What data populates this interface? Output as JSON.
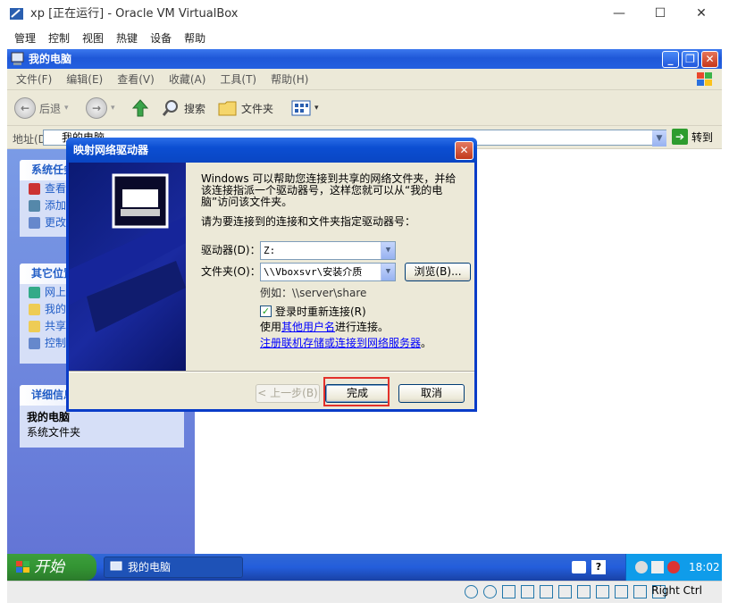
{
  "host": {
    "title": "xp [正在运行] - Oracle VM VirtualBox",
    "menu": [
      "管理",
      "控制",
      "视图",
      "热键",
      "设备",
      "帮助"
    ],
    "controls": {
      "minimize": "—",
      "maximize": "☐",
      "close": "✕"
    }
  },
  "explorer": {
    "title": "我的电脑",
    "menu": [
      "文件(F)",
      "编辑(E)",
      "查看(V)",
      "收藏(A)",
      "工具(T)",
      "帮助(H)"
    ],
    "toolbar": {
      "back": "后退",
      "search": "搜索",
      "folders": "文件夹"
    },
    "address_label": "地址(D)",
    "address_value": "我的电脑",
    "go_label": "转到",
    "panels": [
      {
        "title": "系统任务",
        "items": [
          "查看系统信息",
          "添加/删除程序",
          "更改一个设置"
        ]
      },
      {
        "title": "其它位置",
        "items": [
          "网上邻居",
          "我的文档",
          "共享文档",
          "控制面板"
        ]
      },
      {
        "title": "详细信息",
        "name": "我的电脑",
        "desc": "系统文件夹"
      }
    ]
  },
  "dialog": {
    "title": "映射网络驱动器",
    "description": "Windows 可以帮助您连接到共享的网络文件夹，并给该连接指派一个驱动器号，这样您就可以从“我的电脑”访问该文件夹。",
    "instruction": "请为要连接到的连接和文件夹指定驱动器号：",
    "drive_label": "驱动器(D)：",
    "drive_value": "Z:",
    "folder_label": "文件夹(O)：",
    "folder_value": "\\\\Vboxsvr\\安装介质",
    "browse_label": "浏览(B)...",
    "example": "例如：\\\\server\\share",
    "reconnect_label": "登录时重新连接(R)",
    "reconnect_checked": true,
    "other_user_prefix": "使用",
    "other_user_link": "其他用户名",
    "other_user_suffix": "进行连接。",
    "register_link": "注册联机存储或连接到网络服务器",
    "register_suffix": "。",
    "back_button": "< 上一步(B)",
    "finish_button": "完成",
    "cancel_button": "取消"
  },
  "taskbar": {
    "start": "开始",
    "task": "我的电脑",
    "clock": "18:02"
  },
  "vbox_status": {
    "host_key": "Right Ctrl"
  }
}
